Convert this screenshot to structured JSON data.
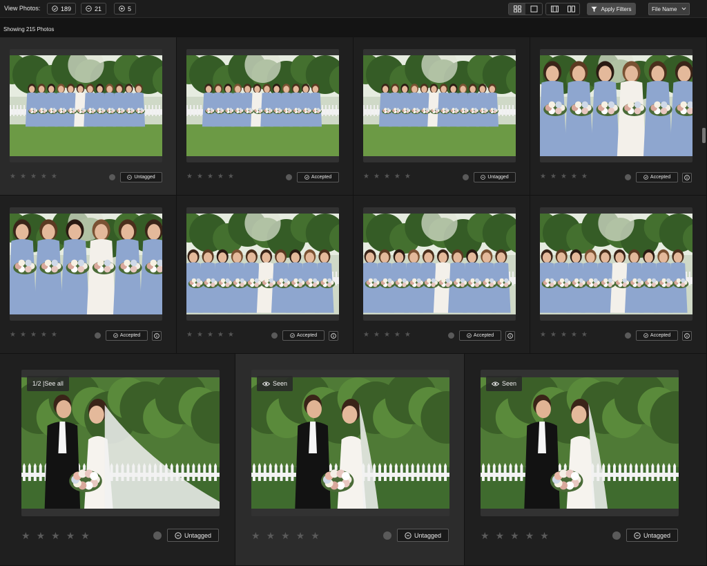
{
  "toolbar": {
    "view_label": "View Photos:",
    "counts": [
      {
        "icon": "check-circle-icon",
        "value": "189"
      },
      {
        "icon": "minus-circle-icon",
        "value": "21"
      },
      {
        "icon": "plus-circle-icon",
        "value": "5"
      }
    ],
    "apply_filters_label": "Apply Filters",
    "sort_value": "File Name"
  },
  "showing_label": "Showing 215 Photos",
  "grid_small": [
    {
      "status": "Untagged",
      "status_icon": "minus-circle-icon",
      "rating": 0,
      "scene": "group-wide-1"
    },
    {
      "status": "Accepted",
      "status_icon": "check-circle-icon",
      "rating": 0,
      "scene": "group-wide-2"
    },
    {
      "status": "Untagged",
      "status_icon": "minus-circle-icon",
      "rating": 0,
      "scene": "group-wide-3"
    },
    {
      "status": "Accepted",
      "status_icon": "check-circle-icon",
      "rating": 0,
      "scene": "group-close-1"
    },
    {
      "status": "Accepted",
      "status_icon": "check-circle-icon",
      "rating": 0,
      "scene": "group-close-2"
    },
    {
      "status": "Accepted",
      "status_icon": "check-circle-icon",
      "rating": 0,
      "scene": "group-mid-1"
    },
    {
      "status": "Accepted",
      "status_icon": "check-circle-icon",
      "rating": 0,
      "scene": "group-mid-2"
    },
    {
      "status": "Accepted",
      "status_icon": "check-circle-icon",
      "rating": 0,
      "scene": "group-mid-3"
    }
  ],
  "grid_large": [
    {
      "badge": "1/2 |See all",
      "badge_icon": "",
      "status": "Untagged",
      "status_icon": "minus-circle-icon",
      "rating": 0,
      "scene": "couple-veil"
    },
    {
      "badge": "Seen",
      "badge_icon": "eye-icon",
      "status": "Untagged",
      "status_icon": "minus-circle-icon",
      "rating": 0,
      "scene": "couple-fence-1"
    },
    {
      "badge": "Seen",
      "badge_icon": "eye-icon",
      "status": "Untagged",
      "status_icon": "minus-circle-icon",
      "rating": 0,
      "scene": "couple-fence-2"
    }
  ],
  "colors": {
    "background": "#141414",
    "card": "#1f1f1f",
    "dress_blue": "#8ea6cf",
    "foliage": "#3f6b2e",
    "grass": "#6c9a45"
  }
}
